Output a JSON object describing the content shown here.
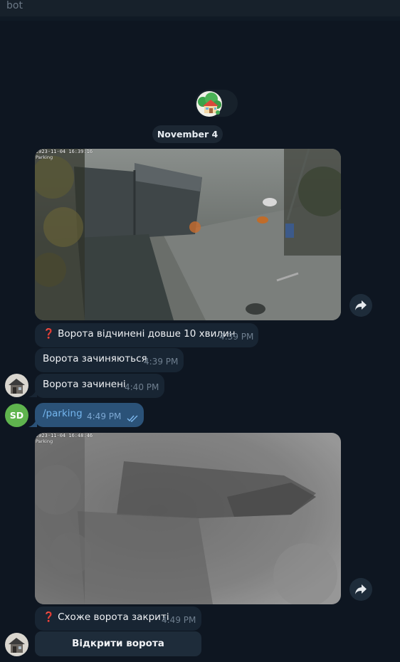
{
  "header": {
    "title": "bot"
  },
  "date_separator": "November 4",
  "messages": [
    {
      "photo": {
        "timestamp": "2023-11-04 16:39:16",
        "camera": "Parking"
      },
      "text": "❓ Ворота відчинені довше 10 хвилин",
      "time": "4:39 PM"
    },
    {
      "text": "Ворота зачиняються",
      "time": "4:39 PM"
    },
    {
      "text": "Ворота зачинені",
      "time": "4:40 PM"
    },
    {
      "text": "/parking",
      "time": "4:49 PM",
      "outgoing": true
    },
    {
      "photo": {
        "timestamp": "2023-11-04 16:48:46",
        "camera": "Parking"
      },
      "text": "❓ Схоже ворота закриті",
      "time": "4:49 PM"
    }
  ],
  "user_avatar": {
    "initials": "SD",
    "color": "#5fb44e"
  },
  "inline_button": {
    "label": "Відкрити ворота"
  },
  "icons": {
    "share": "share-arrow-icon",
    "read": "double-check-icon",
    "house": "house-emoji-icon"
  },
  "colors": {
    "background": "#0e1621",
    "incoming_bubble": "#182533",
    "outgoing_bubble": "#2b5278",
    "link": "#74b6ee"
  }
}
